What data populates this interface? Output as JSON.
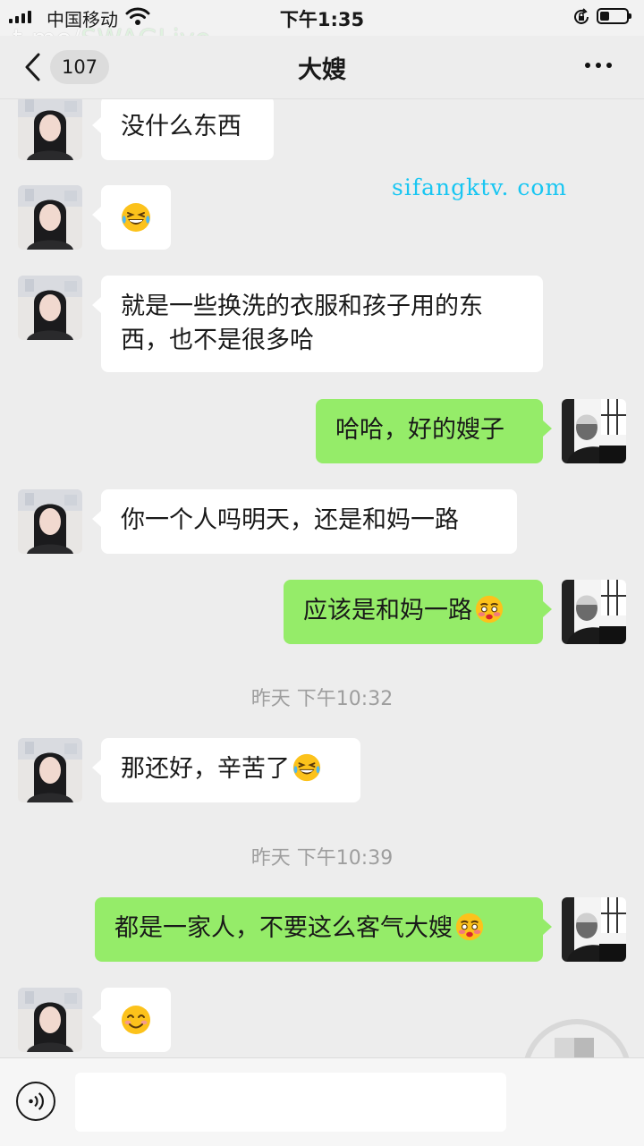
{
  "status_bar": {
    "carrier": "中国移动",
    "time": "下午1:35",
    "battery_level": 0.35,
    "overlay_watermark_part1": "t.me/",
    "overlay_watermark_part2": "SWAGLive"
  },
  "nav": {
    "unread_count": "107",
    "title": "大嫂"
  },
  "chat": {
    "site_watermark": "sifangktv. com",
    "messages": [
      {
        "side": "in",
        "text": "没什么东西",
        "emoji": ""
      },
      {
        "side": "in",
        "text": "",
        "emoji": "laugh-cry"
      },
      {
        "side": "in",
        "text": "就是一些换洗的衣服和孩子用的东\n西，也不是很多哈",
        "emoji": ""
      },
      {
        "side": "out",
        "text": "哈哈，好的嫂子",
        "emoji": ""
      },
      {
        "side": "in",
        "text": "你一个人吗明天，还是和妈一路",
        "emoji": ""
      },
      {
        "side": "out",
        "text": "应该是和妈一路",
        "emoji": "shy-face"
      },
      {
        "side": "in",
        "text": "那还好，辛苦了",
        "emoji": "laugh-cry"
      },
      {
        "side": "out",
        "text": "都是一家人，不要这么客气大嫂",
        "emoji": "shy-face"
      },
      {
        "side": "in",
        "text": "",
        "emoji": "smile"
      }
    ],
    "timestamps": [
      "昨天 下午10:32",
      "昨天 下午10:39"
    ]
  },
  "colors": {
    "outgoing_bubble": "#95ec69",
    "incoming_bubble": "#ffffff",
    "background": "#ededed",
    "watermark": "#18c6f2"
  }
}
